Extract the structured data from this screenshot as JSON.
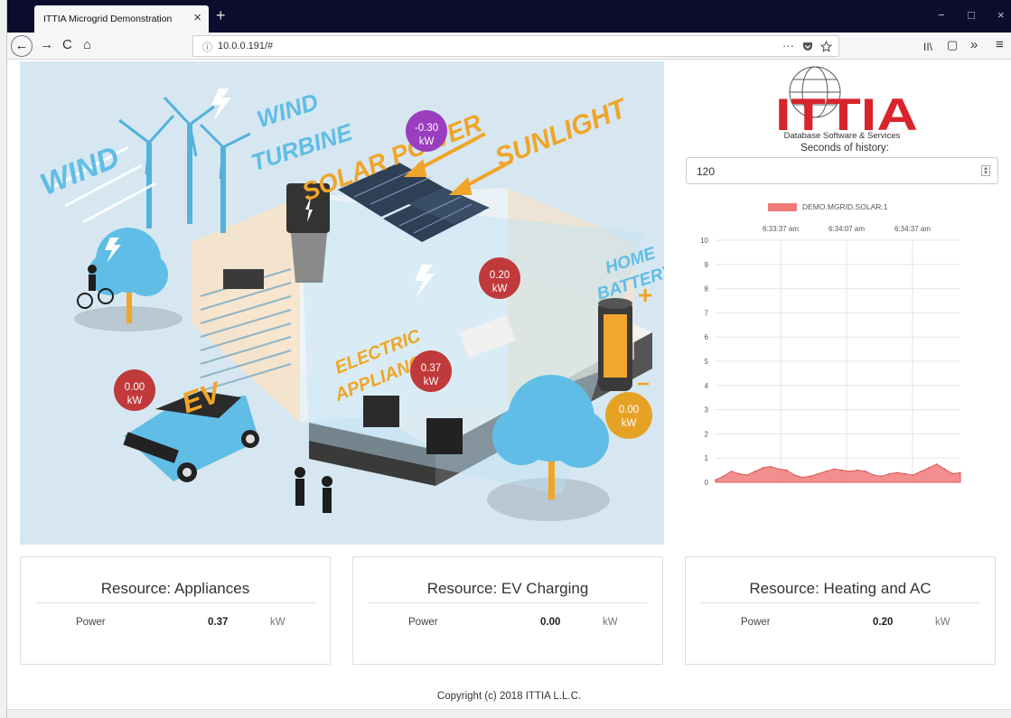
{
  "browser": {
    "tab_title": "ITTIA Microgrid Demonstration",
    "tab_close": "×",
    "new_tab": "+",
    "url_prefix": "ⓘ",
    "url": "10.0.0.191/#",
    "url_more": "···",
    "back": "←",
    "forward": "→",
    "reload": "C",
    "home": "⌂",
    "library": "II\\",
    "sidebar": "▢",
    "overflow": "»",
    "menu": "≡",
    "minimize": "−",
    "restore": "□",
    "close": "×"
  },
  "scene": {
    "labels": {
      "wind": "WIND",
      "wind_turbine_1": "WIND",
      "wind_turbine_2": "TURBINE",
      "solar_power": "SOLAR POWER",
      "sunlight": "SUNLIGHT",
      "home_battery_1": "HOME",
      "home_battery_2": "BATTERY",
      "electric_1": "ELECTRIC",
      "electric_2": "APPLIANCE",
      "ev": "EV",
      "plus": "+",
      "minus": "−"
    },
    "bubbles": {
      "solar": {
        "value": "-0.30",
        "unit": "kW",
        "color": "#9b3dbf"
      },
      "heating": {
        "value": "0.20",
        "unit": "kW",
        "color": "#c0393b"
      },
      "appliance": {
        "value": "0.37",
        "unit": "kW",
        "color": "#c0393b"
      },
      "ev": {
        "value": "0.00",
        "unit": "kW",
        "color": "#c0393b"
      },
      "battery": {
        "value": "0.00",
        "unit": "kW",
        "color": "#e6a225"
      }
    }
  },
  "logo": {
    "text": "ITTIA",
    "subtitle": "Database Software & Services",
    "color": "#d8242c"
  },
  "history": {
    "label": "Seconds of history:",
    "value": "120"
  },
  "chart_data": {
    "type": "area",
    "series": [
      {
        "name": "DEMO.MGRID.SOLAR.1",
        "color": "#f07a7a",
        "values": [
          0.1,
          0.25,
          0.45,
          0.35,
          0.3,
          0.45,
          0.6,
          0.65,
          0.55,
          0.5,
          0.3,
          0.2,
          0.25,
          0.35,
          0.45,
          0.55,
          0.5,
          0.45,
          0.5,
          0.45,
          0.3,
          0.25,
          0.35,
          0.4,
          0.35,
          0.3,
          0.45,
          0.6,
          0.75,
          0.55,
          0.35,
          0.4
        ]
      }
    ],
    "x_ticks": [
      "6:33:37 am",
      "6:34:07 am",
      "6:34:37 am"
    ],
    "y_ticks": [
      "0",
      "1",
      "2",
      "3",
      "4",
      "5",
      "6",
      "7",
      "8",
      "9",
      "10"
    ],
    "ylim": [
      0,
      10
    ],
    "grid": true,
    "legend": "top"
  },
  "cards": [
    {
      "title": "Resource: Appliances",
      "label": "Power",
      "value": "0.37",
      "unit": "kW"
    },
    {
      "title": "Resource: EV Charging",
      "label": "Power",
      "value": "0.00",
      "unit": "kW"
    },
    {
      "title": "Resource: Heating and AC",
      "label": "Power",
      "value": "0.20",
      "unit": "kW"
    }
  ],
  "footer": "Copyright (c) 2018 ITTIA L.L.C."
}
